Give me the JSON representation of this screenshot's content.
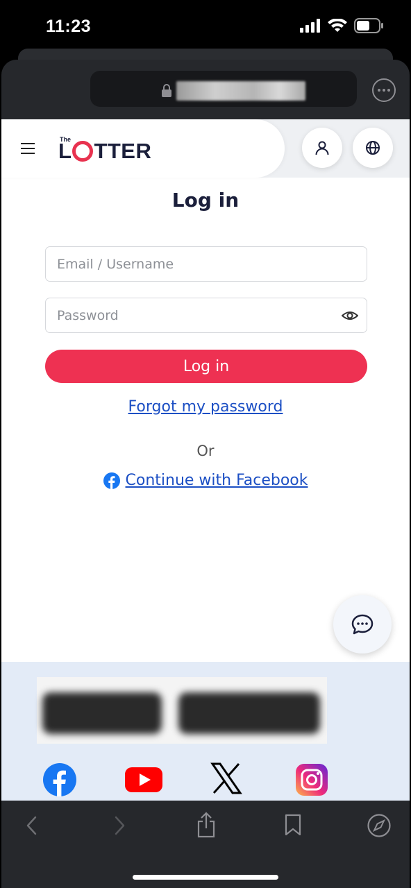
{
  "status_bar": {
    "time": "11:23"
  },
  "browser": {
    "more_label": "⋯"
  },
  "header": {
    "logo_small": "The",
    "logo_left": "L",
    "logo_right": "TTER"
  },
  "login": {
    "title": "Log in",
    "email_placeholder": "Email / Username",
    "password_placeholder": "Password",
    "submit_label": "Log in",
    "forgot_label": "Forgot my password",
    "or_label": "Or",
    "facebook_label": "Continue with Facebook"
  },
  "colors": {
    "accent": "#ee3152",
    "link": "#1c4fc4",
    "brand_navy": "#1b1f3b",
    "footer_bg": "#e3ebf7"
  },
  "footer": {
    "social_icons": [
      "facebook-icon",
      "youtube-icon",
      "x-icon",
      "instagram-icon"
    ]
  },
  "toolbar": {
    "icons": [
      "back-icon",
      "forward-icon",
      "share-icon",
      "bookmarks-icon",
      "compass-icon"
    ]
  }
}
